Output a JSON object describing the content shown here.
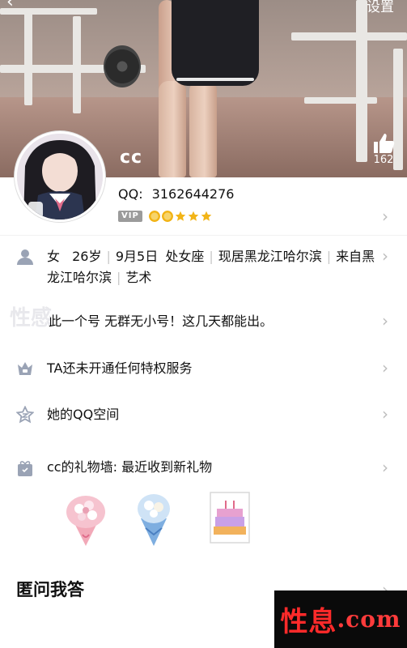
{
  "nav": {
    "back_icon": "chevron-left-icon",
    "settings_label": "设置"
  },
  "profile": {
    "nickname": "cc",
    "qq_label": "QQ:",
    "qq_number": "3162644276",
    "vip_badge": "VIP",
    "like_count": "162",
    "like_icon": "thumbs-up-icon"
  },
  "info": {
    "icon": "user-icon",
    "gender": "女",
    "age": "26岁",
    "birthday": "9月5日",
    "zodiac": "处女座",
    "residence": "现居黑龙江哈尔滨",
    "hometown": "来自黑龙江哈尔滨",
    "occupation": "艺术"
  },
  "signature": {
    "prefix": "性感",
    "text": "此一个号 无群无小号！这几天都能出。"
  },
  "privilege": {
    "icon": "crown-icon",
    "label": "TA还未开通任何特权服务"
  },
  "qzone": {
    "icon": "star-icon",
    "label": "她的QQ空间"
  },
  "gift_wall": {
    "icon": "gift-icon",
    "label": "cc的礼物墙: 最近收到新礼物",
    "gifts": [
      {
        "name": "pink-bouquet-gift"
      },
      {
        "name": "blue-bouquet-gift"
      },
      {
        "name": "birthday-card-gift"
      }
    ]
  },
  "anon_qa": {
    "title": "匿问我答"
  },
  "watermark": {
    "text": "性息",
    "domain": ".com"
  },
  "colors": {
    "chevron": "#bdbdbd",
    "text": "#111111",
    "icon": "#9aa3b5",
    "watermark": "#ff2a2a"
  }
}
